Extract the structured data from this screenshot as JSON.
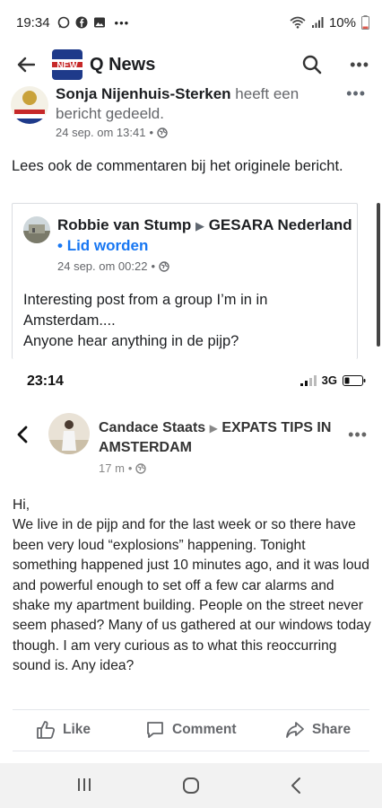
{
  "status_bar": {
    "time": "19:34",
    "battery": "10%",
    "icons": [
      "whatsapp-icon",
      "facebook-icon",
      "gallery-icon",
      "more-dots-icon",
      "wifi-icon",
      "signal-icon",
      "battery-icon"
    ]
  },
  "app_bar": {
    "title": "Q News",
    "logo_text": "NEW",
    "icons": [
      "back-arrow-icon",
      "search-icon",
      "more-icon"
    ]
  },
  "post": {
    "author": "Sonja Nijenhuis-Sterken",
    "action": "heeft een bericht gedeeld.",
    "timestamp": "24 sep. om 13:41",
    "text": "Lees ook de commentaren bij het originele bericht."
  },
  "shared_post": {
    "author": "Robbie van Stump",
    "group": "GESARA Nederland",
    "join_label": "Lid worden",
    "timestamp": "24 sep. om 00:22",
    "text_lines": [
      "Interesting post from a group I’m in in",
      "Amsterdam....",
      "Anyone hear anything in de pijp?"
    ]
  },
  "embedded": {
    "time": "23:14",
    "network": "3G",
    "author": "Candace Staats",
    "group": "EXPATS TIPS IN AMSTERDAM",
    "timestamp": "17 m",
    "text_lines": [
      "Hi,",
      "We live in de pijp and for the last week or so there have been very loud “explosions” happening. Tonight something happened just 10 minutes ago, and it was loud and powerful enough to set off a few car alarms and shake my apartment building. People on the street never seem phased? Many of us gathered at our windows today though. I am very curious as to what this reoccurring sound is. Any idea?"
    ],
    "actions": {
      "like": "Like",
      "comment": "Comment",
      "share": "Share"
    }
  },
  "colors": {
    "link_blue": "#1877f2",
    "text_dark": "#1c1e21",
    "text_gray": "#65676b"
  }
}
